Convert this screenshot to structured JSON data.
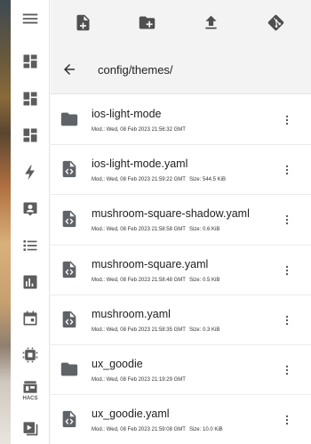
{
  "sidebar": {
    "items": [
      {
        "icon": "menu-icon"
      },
      {
        "icon": "dashboard-icon"
      },
      {
        "icon": "dashboard-icon"
      },
      {
        "icon": "dashboard-icon"
      },
      {
        "icon": "lightning-icon"
      },
      {
        "icon": "account-box-icon"
      },
      {
        "icon": "list-icon"
      },
      {
        "icon": "bar-chart-icon"
      },
      {
        "icon": "calendar-icon"
      },
      {
        "icon": "chip-icon"
      },
      {
        "icon": "hacs-icon",
        "label": "HACS"
      },
      {
        "icon": "media-icon"
      }
    ]
  },
  "toolbar": {
    "actions": [
      {
        "icon": "file-plus-icon"
      },
      {
        "icon": "folder-plus-icon"
      },
      {
        "icon": "upload-icon"
      },
      {
        "icon": "git-icon"
      }
    ]
  },
  "path": {
    "current": "config/themes/"
  },
  "files": [
    {
      "type": "folder",
      "name": "ios-light-mode",
      "mod_label": "Mod.:",
      "modified": "Wed, 08 Feb 2023 21:56:32 GMT",
      "size_label": "",
      "size": ""
    },
    {
      "type": "file",
      "name": "ios-light-mode.yaml",
      "mod_label": "Mod.:",
      "modified": "Wed, 08 Feb 2023 21:59:22 GMT",
      "size_label": "Size:",
      "size": "544.5 KiB"
    },
    {
      "type": "file",
      "name": "mushroom-square-shadow.yaml",
      "mod_label": "Mod.:",
      "modified": "Wed, 08 Feb 2023 21:58:58 GMT",
      "size_label": "Size:",
      "size": "0.6 KiB"
    },
    {
      "type": "file",
      "name": "mushroom-square.yaml",
      "mod_label": "Mod.:",
      "modified": "Wed, 08 Feb 2023 21:58:48 GMT",
      "size_label": "Size:",
      "size": "0.5 KiB"
    },
    {
      "type": "file",
      "name": "mushroom.yaml",
      "mod_label": "Mod.:",
      "modified": "Wed, 08 Feb 2023 21:58:35 GMT",
      "size_label": "Size:",
      "size": "0.3 KiB"
    },
    {
      "type": "folder",
      "name": "ux_goodie",
      "mod_label": "Mod.:",
      "modified": "Wed, 08 Feb 2023 21:19:29 GMT",
      "size_label": "",
      "size": ""
    },
    {
      "type": "file",
      "name": "ux_goodie.yaml",
      "mod_label": "Mod.:",
      "modified": "Wed, 08 Feb 2023 21:59:08 GMT",
      "size_label": "Size:",
      "size": "10.0 KiB"
    }
  ]
}
